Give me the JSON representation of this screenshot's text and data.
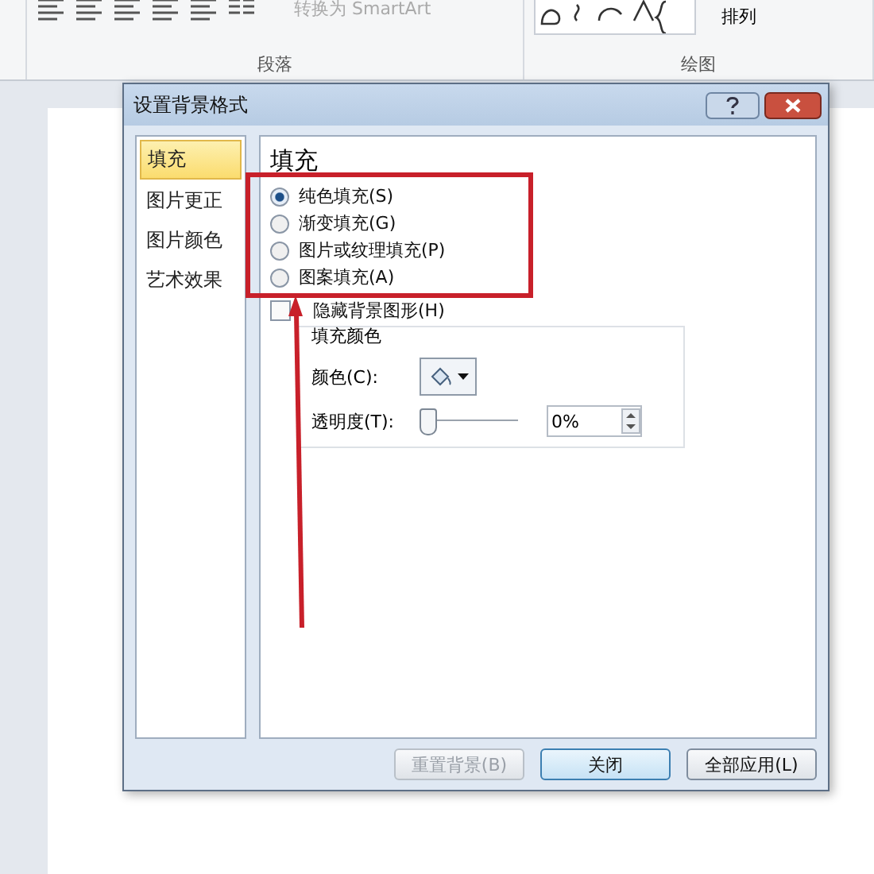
{
  "ribbon": {
    "smartart_button": {
      "label": "转换为 SmartArt",
      "disabled": true
    },
    "arrange_button": {
      "label": "排列"
    },
    "group_labels": [
      "段落",
      "绘图"
    ]
  },
  "dialog": {
    "title": "设置背景格式",
    "nav_items": [
      {
        "label": "填充",
        "selected": true
      },
      {
        "label": "图片更正",
        "selected": false
      },
      {
        "label": "图片颜色",
        "selected": false
      },
      {
        "label": "艺术效果",
        "selected": false
      }
    ],
    "heading": "填充",
    "fill_options": [
      {
        "label": "纯色填充(S)",
        "selected": true
      },
      {
        "label": "渐变填充(G)",
        "selected": false
      },
      {
        "label": "图片或纹理填充(P)",
        "selected": false
      },
      {
        "label": "图案填充(A)",
        "selected": false
      }
    ],
    "hide_background": {
      "label": "隐藏背景图形(H)",
      "checked": false
    },
    "fill_color": {
      "title": "填充颜色",
      "color_label": "颜色(C):",
      "transparency_label": "透明度(T):",
      "level": 0,
      "value": "0%"
    },
    "buttons": [
      {
        "label": "重置背景(B)",
        "disabled": true,
        "default": false
      },
      {
        "label": "关闭",
        "disabled": false,
        "default": true
      },
      {
        "label": "全部应用(L)",
        "disabled": false,
        "default": false
      }
    ]
  }
}
